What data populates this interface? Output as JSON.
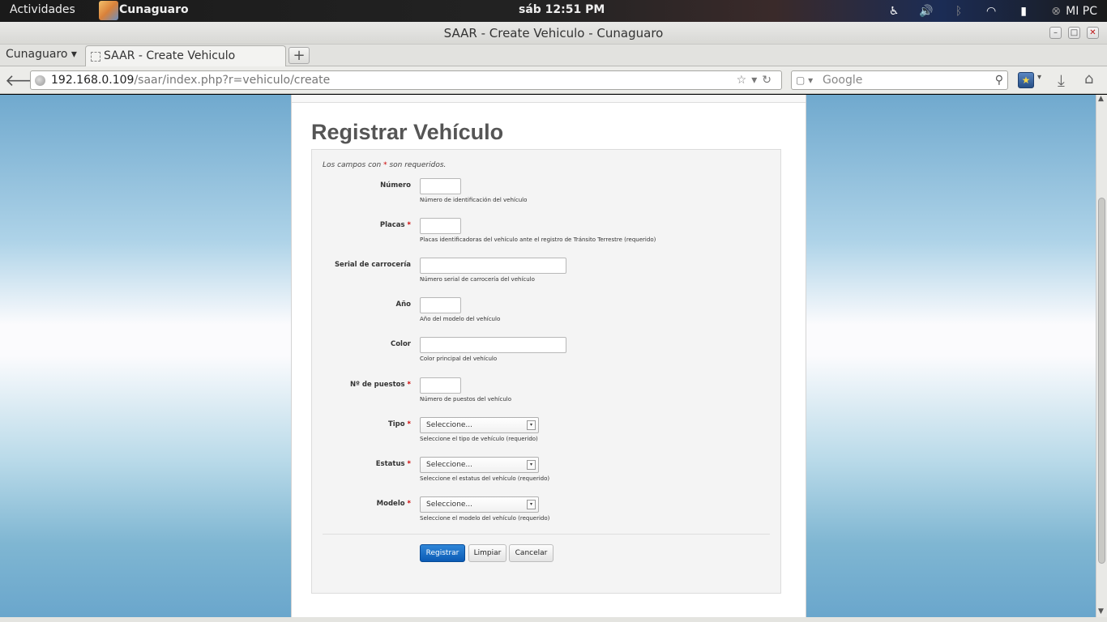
{
  "topbar": {
    "activities": "Actividades",
    "app_name": "Cunaguaro",
    "clock": "sáb 12:51 PM",
    "user": "MI PC",
    "tray_icons": [
      "accessibility-icon",
      "volume-icon",
      "bluetooth-icon",
      "wifi-icon",
      "battery-icon",
      "user-status-icon"
    ]
  },
  "window": {
    "title": "SAAR - Create Vehiculo - Cunaguaro",
    "buttons": [
      "minimize",
      "maximize",
      "close"
    ]
  },
  "browser": {
    "profile": "Cunaguaro",
    "tab_title": "SAAR - Create Vehiculo",
    "new_tab": "+",
    "url_host": "192.168.0.109",
    "url_path": "/saar/index.php?r=vehiculo/create",
    "search_placeholder": "Google"
  },
  "page": {
    "heading": "Registrar Vehículo",
    "required_note_prefix": "Los campos con ",
    "required_marker": "*",
    "required_note_suffix": " son requeridos.",
    "fields": [
      {
        "label": "Número",
        "required": false,
        "hint": "Número de identificación del vehículo",
        "value": "",
        "kind": "input"
      },
      {
        "label": "Placas",
        "required": true,
        "hint": "Placas identificadoras del vehículo ante el registro de Tránsito Terrestre (requerido)",
        "value": "",
        "kind": "input"
      },
      {
        "label": "Serial de carrocería",
        "required": false,
        "hint": "Número serial de carrocería del vehículo",
        "value": "",
        "kind": "input"
      },
      {
        "label": "Año",
        "required": false,
        "hint": "Año del modelo del vehículo",
        "value": "",
        "kind": "input"
      },
      {
        "label": "Color",
        "required": false,
        "hint": "Color principal del vehículo",
        "value": "",
        "kind": "input"
      },
      {
        "label": "Nº de puestos",
        "required": true,
        "hint": "Número de puestos del vehículo",
        "value": "",
        "kind": "input"
      },
      {
        "label": "Tipo",
        "required": true,
        "hint": "Seleccione el tipo de vehículo (requerido)",
        "value": "Seleccione...",
        "kind": "select"
      },
      {
        "label": "Estatus",
        "required": true,
        "hint": "Seleccione el estatus del vehículo (requerido)",
        "value": "Seleccione...",
        "kind": "select"
      },
      {
        "label": "Modelo",
        "required": true,
        "hint": "Seleccione el modelo del vehículo (requerido)",
        "value": "Seleccione...",
        "kind": "select"
      }
    ],
    "buttons": {
      "submit": "Registrar",
      "reset": "Limpiar",
      "cancel": "Cancelar"
    }
  },
  "colors": {
    "primary_button": "#0b5bb5",
    "required": "#cc0000",
    "heading": "#555555"
  }
}
